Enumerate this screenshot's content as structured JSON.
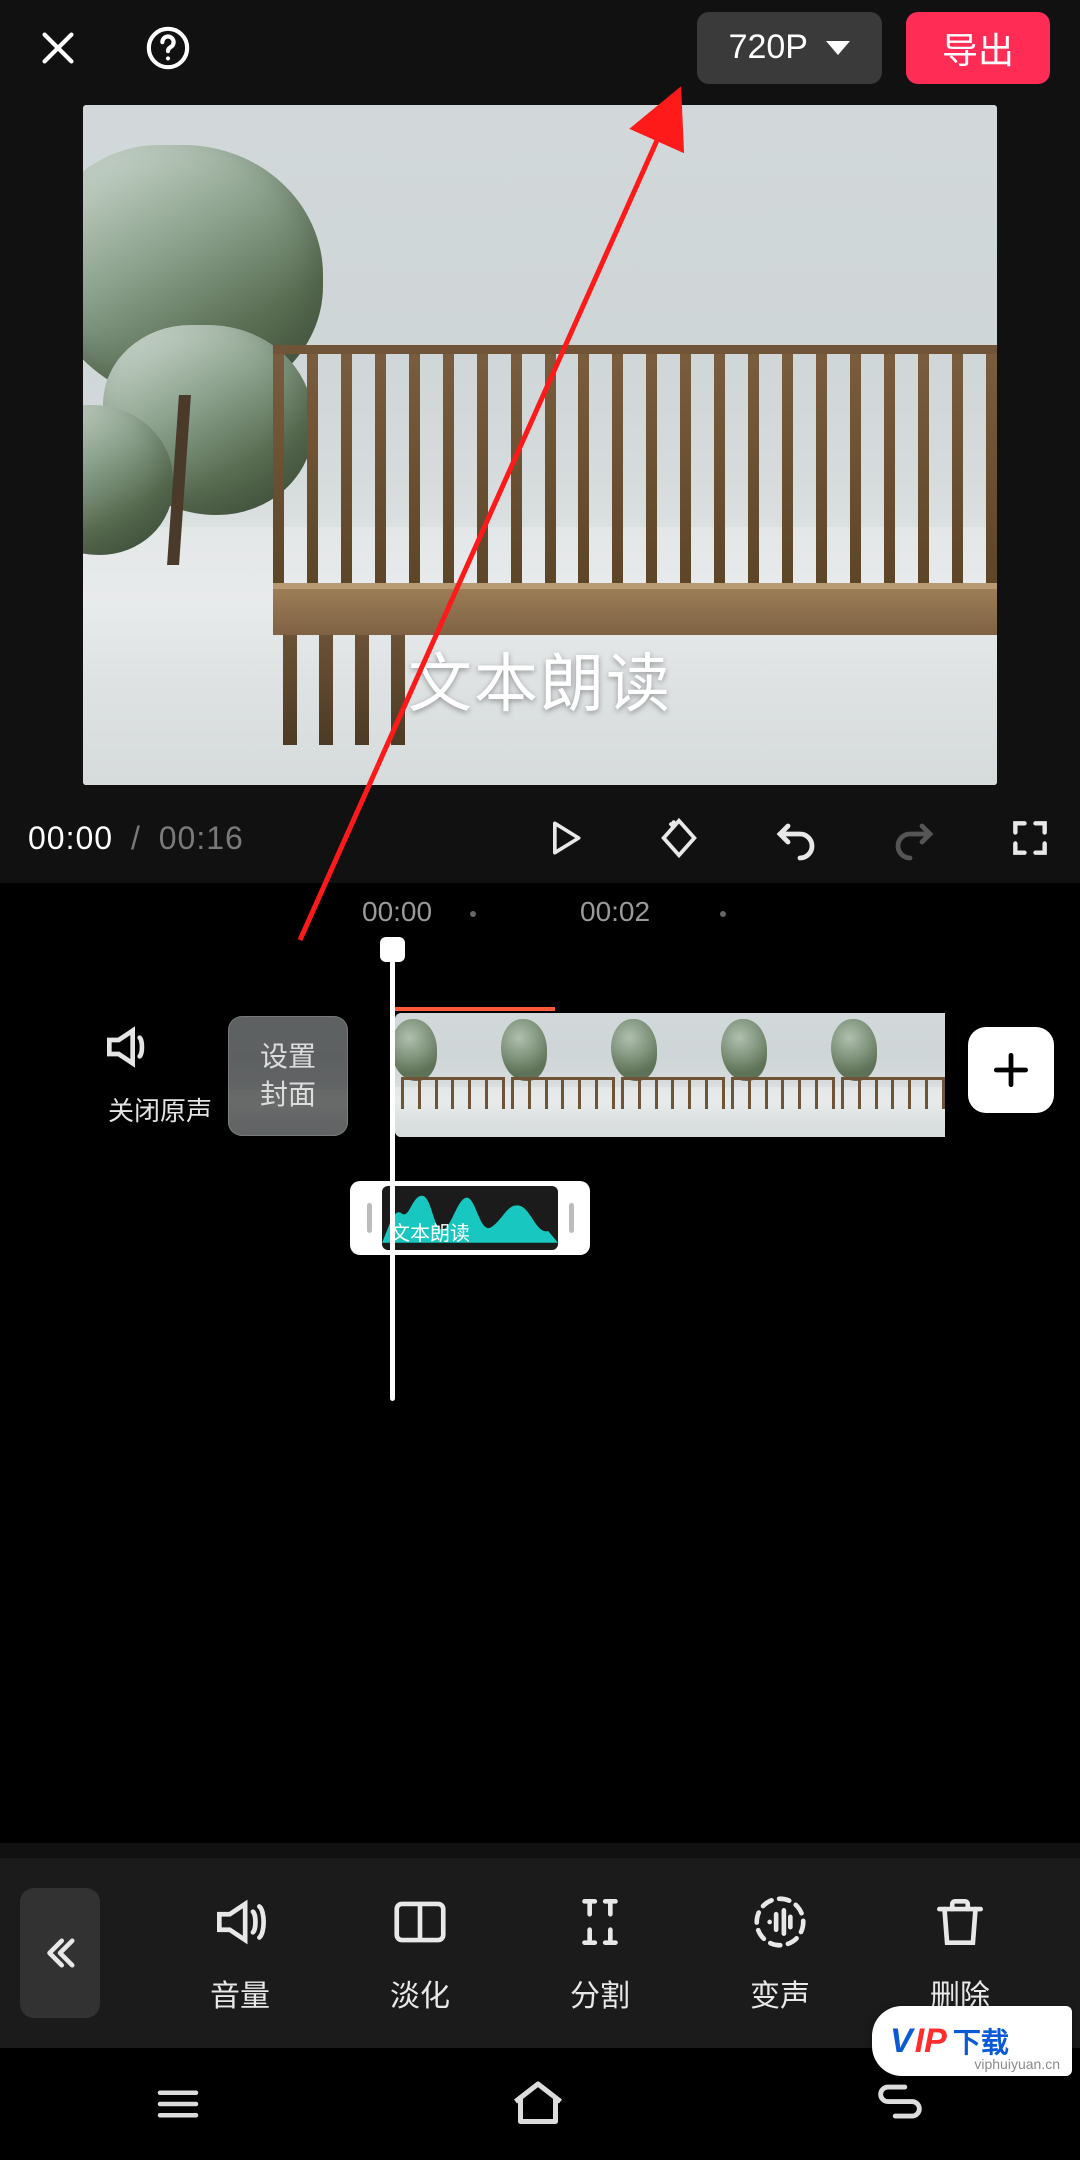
{
  "topbar": {
    "resolution_label": "720P",
    "export_label": "导出"
  },
  "preview": {
    "caption_text": "文本朗读"
  },
  "playback": {
    "current_time": "00:00",
    "separator": "/",
    "total_time": "00:16"
  },
  "ruler": {
    "mark_0": "00:00",
    "mark_2": "00:02"
  },
  "video_track": {
    "mute_label": "关闭原声",
    "cover_line1": "设置",
    "cover_line2": "封面"
  },
  "audio_clip": {
    "label": "文本朗读"
  },
  "tools": {
    "volume": "音量",
    "fade": "淡化",
    "split": "分割",
    "voice_change": "变声",
    "delete": "删除"
  },
  "watermark": {
    "brand_left": "V",
    "brand_mid": "IP",
    "brand_cn": "下载",
    "sub": "viphuiyuan.cn"
  },
  "colors": {
    "accent": "#ff2d55",
    "wave": "#18c7c0"
  }
}
